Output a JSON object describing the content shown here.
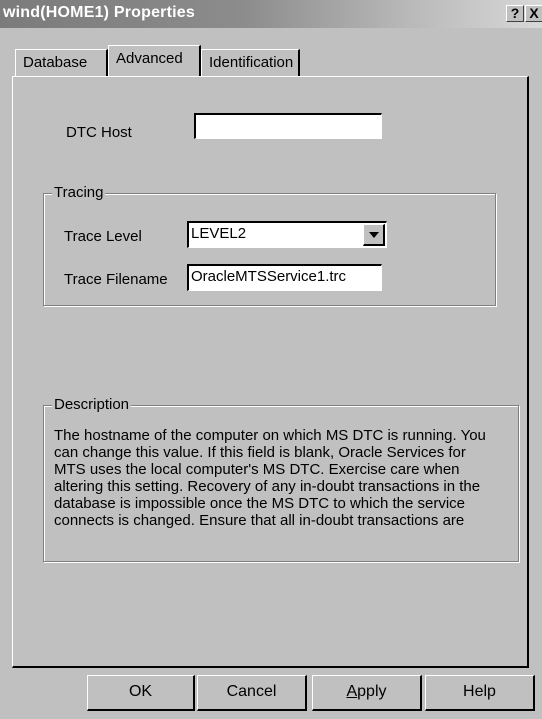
{
  "window": {
    "title": "wind(HOME1) Properties",
    "help_label": "?",
    "close_label": "X"
  },
  "tabs": [
    {
      "label": "Database"
    },
    {
      "label": "Advanced",
      "active": true
    },
    {
      "label": "Identification"
    }
  ],
  "dtc_host": {
    "label": "DTC Host",
    "value": ""
  },
  "tracing": {
    "group_title": "Tracing",
    "trace_level_label": "Trace Level",
    "trace_level_value": "LEVEL2",
    "trace_filename_label": "Trace Filename",
    "trace_filename_value": "OracleMTSService1.trc"
  },
  "description": {
    "group_title": "Description",
    "text": "The hostname of the computer on which MS DTC is running. You\ncan change this value. If this field is blank, Oracle Services for\nMTS uses the local computer's MS DTC. Exercise care when\naltering this setting. Recovery of any in-doubt transactions in the\ndatabase is impossible once the MS DTC to which the service\nconnects is changed. Ensure that all in-doubt transactions are"
  },
  "buttons": {
    "ok": "OK",
    "cancel": "Cancel",
    "apply_mnemonic": "A",
    "apply_rest": "pply",
    "help": "Help"
  }
}
